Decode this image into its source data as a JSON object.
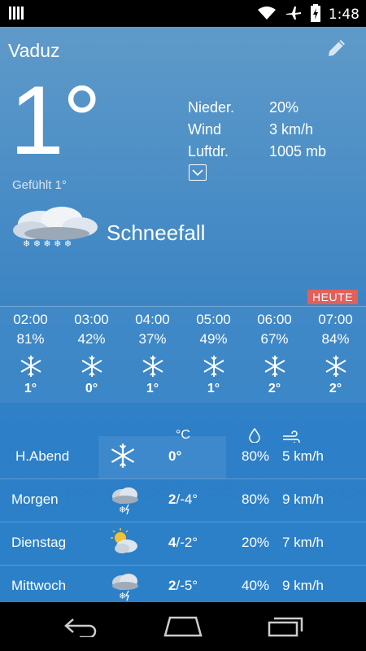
{
  "status_bar": {
    "time": "1:48",
    "icons": [
      "bars-notification-icon",
      "wifi-icon",
      "airplane-icon",
      "battery-charging-icon"
    ]
  },
  "location": {
    "city": "Vaduz"
  },
  "current": {
    "temperature": "1°",
    "feels_like": "Gefühlt 1°",
    "condition": "Schneefall",
    "details": [
      {
        "label": "Nieder.",
        "value": "20%"
      },
      {
        "label": "Wind",
        "value": "3 km/h"
      },
      {
        "label": "Luftdr.",
        "value": "1005 mb"
      }
    ]
  },
  "today_badge": "HEUTE",
  "hourly": [
    {
      "time": "02:00",
      "pct": "81%",
      "icon": "snowflake-icon",
      "temp": "1°"
    },
    {
      "time": "03:00",
      "pct": "42%",
      "icon": "snowflake-icon",
      "temp": "0°"
    },
    {
      "time": "04:00",
      "pct": "37%",
      "icon": "snowflake-icon",
      "temp": "1°"
    },
    {
      "time": "05:00",
      "pct": "49%",
      "icon": "snowflake-icon",
      "temp": "1°"
    },
    {
      "time": "06:00",
      "pct": "67%",
      "icon": "snowflake-icon",
      "temp": "2°"
    },
    {
      "time": "07:00",
      "pct": "84%",
      "icon": "snowflake-icon",
      "temp": "2°"
    }
  ],
  "daily_header": {
    "temp_unit": "°C"
  },
  "daily": [
    {
      "day": "H.Abend",
      "icon": "snowflake-icon",
      "temp_hi": "0°",
      "temp_lo": "",
      "precip": "80%",
      "wind": "5 km/h"
    },
    {
      "day": "Morgen",
      "icon": "snow-cloud-icon",
      "temp_hi": "2",
      "temp_lo": "/-4°",
      "precip": "80%",
      "wind": "9 km/h"
    },
    {
      "day": "Dienstag",
      "icon": "sun-cloud-icon",
      "temp_hi": "4",
      "temp_lo": "/-2°",
      "precip": "20%",
      "wind": "7 km/h"
    },
    {
      "day": "Mittwoch",
      "icon": "snow-cloud-icon",
      "temp_hi": "2",
      "temp_lo": "/-5°",
      "precip": "40%",
      "wind": "9 km/h"
    }
  ]
}
